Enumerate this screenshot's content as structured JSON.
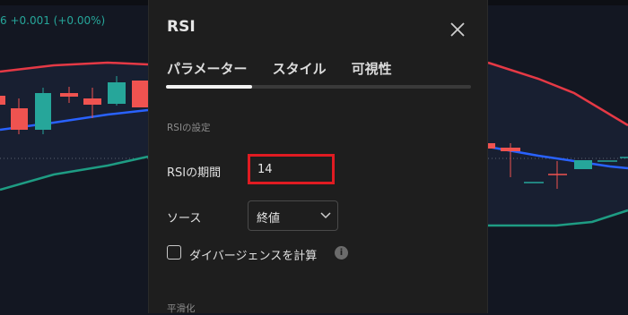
{
  "chart": {
    "price_change": "6 +0.001 (+0.00%)"
  },
  "dialog": {
    "title": "RSI",
    "tabs": [
      "パラメーター",
      "スタイル",
      "可視性"
    ],
    "active_tab": "パラメーター",
    "settings_section": "RSIの設定",
    "period_label": "RSIの期間",
    "period_value": "14",
    "source_label": "ソース",
    "source_value": "終値",
    "divergence_label": "ダイバージェンスを計算",
    "divergence_checked": false,
    "info_icon": "i",
    "smoothing_section": "平滑化"
  },
  "colors": {
    "chart_background": "#131722",
    "dialog_background": "#1e1e1e",
    "bullish": "#26a69a",
    "bearish": "#ef5350",
    "upper_band": "#e53945",
    "middle_line": "#2962ff",
    "lower_band": "#1e9c83",
    "highlight_box": "#e01b22"
  }
}
